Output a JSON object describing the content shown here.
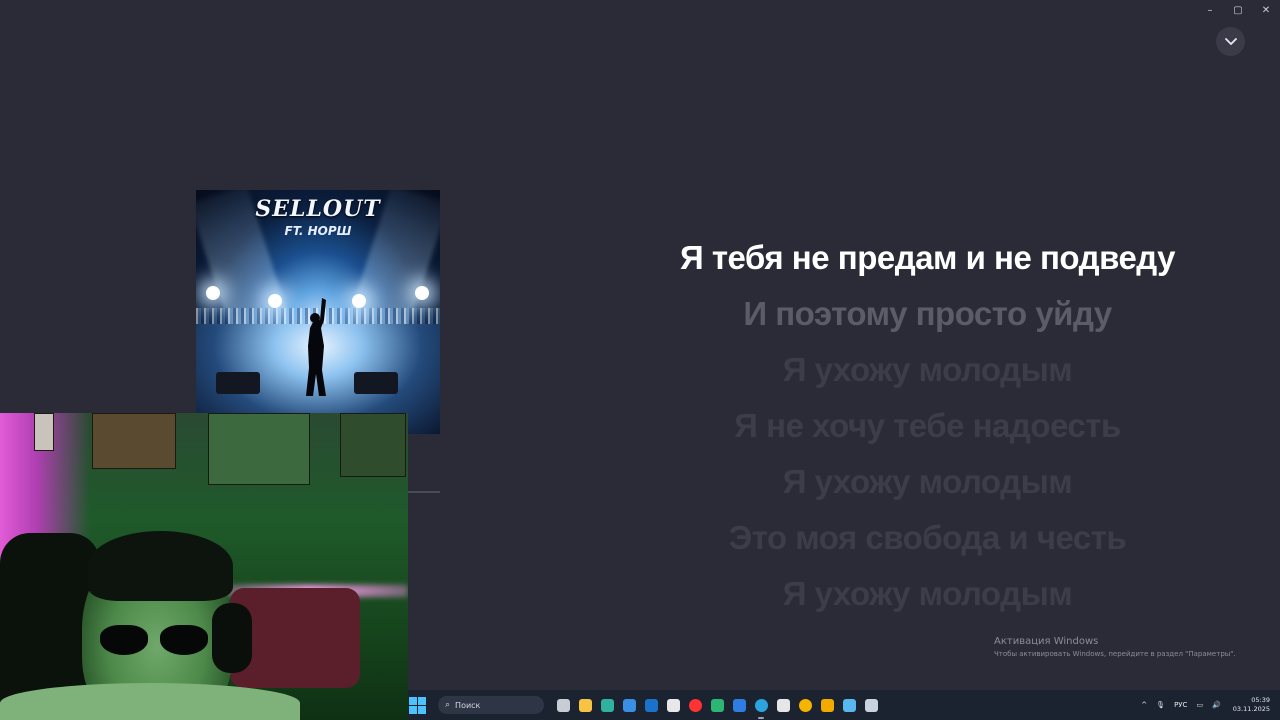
{
  "window": {
    "controls": {
      "minimize": "–",
      "maximize": "▢",
      "close": "✕"
    },
    "collapse_icon": "chevron-down-icon"
  },
  "album": {
    "title": "SELLOUT",
    "featuring": "FT. НОРШ"
  },
  "lyrics": [
    "Я тебя не предам и не подведу",
    "И поэтому просто уйду",
    "Я ухожу молодым",
    "Я не хочу тебе надоесть",
    "Я ухожу молодым",
    "Это моя свобода и честь",
    "Я ухожу молодым"
  ],
  "activation": {
    "title": "Активация Windows",
    "subtitle": "Чтобы активировать Windows, перейдите в раздел \"Параметры\"."
  },
  "taskbar": {
    "search_placeholder": "Поиск",
    "pinned": [
      {
        "name": "task-view-icon",
        "color": "#c8ccd4"
      },
      {
        "name": "file-explorer-icon",
        "color": "#f6c343"
      },
      {
        "name": "edge-icon",
        "color": "#2fb3a0"
      },
      {
        "name": "store-icon",
        "color": "#3a8ee6"
      },
      {
        "name": "outlook-icon",
        "color": "#1a73c9"
      },
      {
        "name": "capcut-icon",
        "color": "#e8e8e8"
      },
      {
        "name": "yandex-browser-icon",
        "color": "#ff3333"
      },
      {
        "name": "torrent-icon",
        "color": "#2bb673"
      },
      {
        "name": "media-player-icon",
        "color": "#2f7de1"
      },
      {
        "name": "telegram-icon",
        "color": "#2aa3df"
      },
      {
        "name": "obs-icon",
        "color": "#e6e6e6"
      },
      {
        "name": "chrome-icon",
        "color": "#f4b400"
      },
      {
        "name": "winamp-icon",
        "color": "#f2a900"
      },
      {
        "name": "photos-icon",
        "color": "#58b7f0"
      },
      {
        "name": "steam-icon",
        "color": "#c9d3df"
      }
    ],
    "tray": {
      "chevron": "^",
      "language": "РУС",
      "time": "05:39",
      "date": "03.11.2025"
    }
  }
}
